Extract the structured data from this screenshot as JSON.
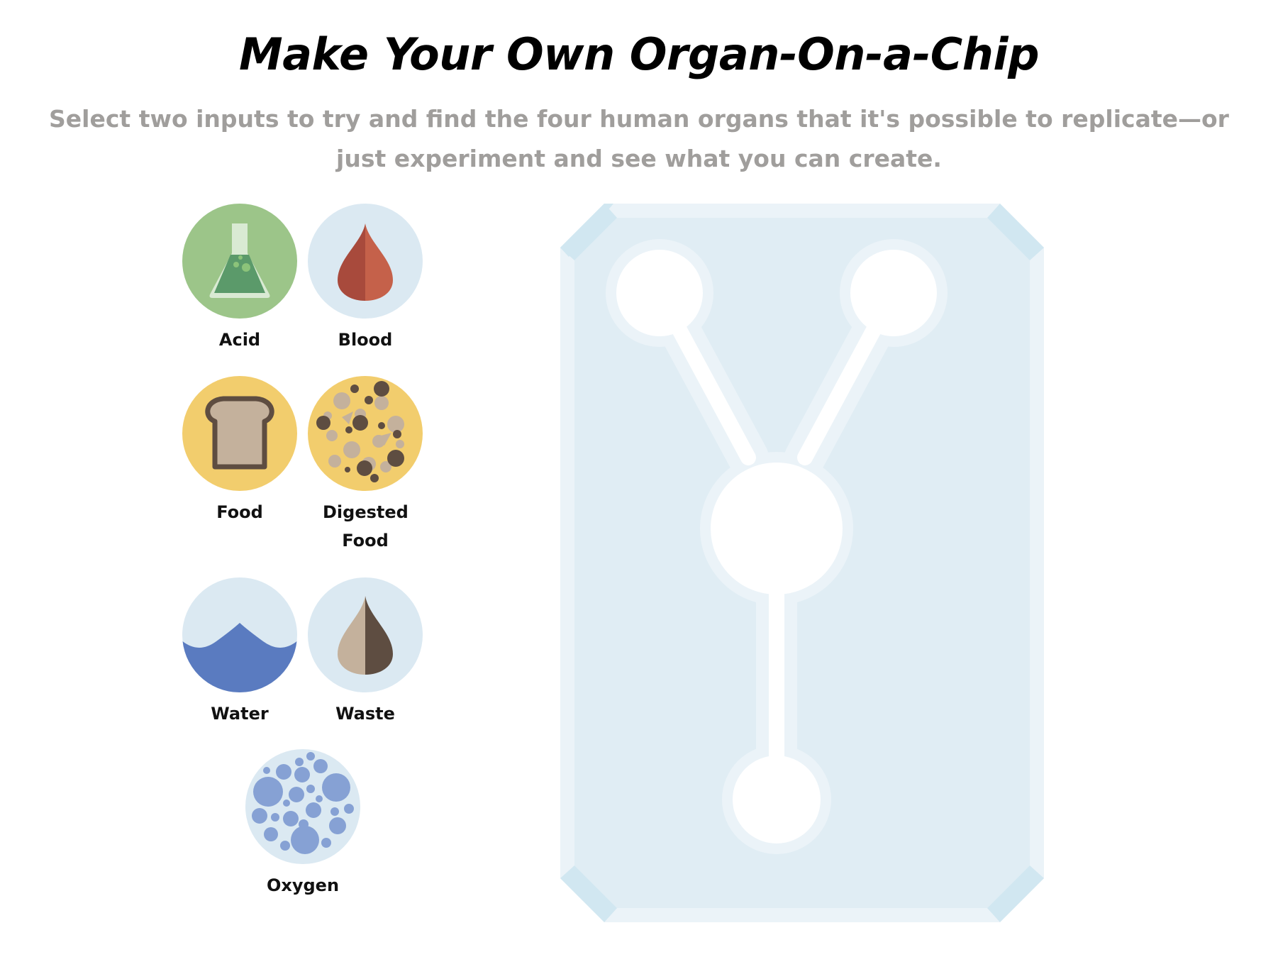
{
  "header": {
    "title": "Make Your Own Organ-On-a-Chip",
    "subtitle": "Select two inputs to try and find the four human organs that it's possible to replicate—or just experiment and see what you can create."
  },
  "inputs": [
    {
      "id": "acid",
      "label": "Acid",
      "icon": "flask-icon",
      "bg": "#9cc589"
    },
    {
      "id": "blood",
      "label": "Blood",
      "icon": "blood-drop-icon",
      "bg": "#dbe9f2"
    },
    {
      "id": "food",
      "label": "Food",
      "icon": "bread-icon",
      "bg": "#f2cd6d"
    },
    {
      "id": "digested-food",
      "label": "Digested Food",
      "icon": "digested-food-icon",
      "bg": "#f2cd6d"
    },
    {
      "id": "water",
      "label": "Water",
      "icon": "water-wave-icon",
      "bg": "#dbe9f2"
    },
    {
      "id": "waste",
      "label": "Waste",
      "icon": "waste-drop-icon",
      "bg": "#dbe9f2"
    },
    {
      "id": "oxygen",
      "label": "Oxygen",
      "icon": "oxygen-bubbles-icon",
      "bg": "#dbe9f2"
    }
  ],
  "chip": {
    "name": "organ-chip",
    "slots": [
      "input-slot-1",
      "input-slot-2",
      "mix-chamber",
      "output-slot"
    ]
  },
  "colors": {
    "chip_fill": "#e0edf4",
    "chip_border": "#ebf3f8",
    "chip_corner": "#d1e7f1",
    "channel": "#ffffff"
  }
}
